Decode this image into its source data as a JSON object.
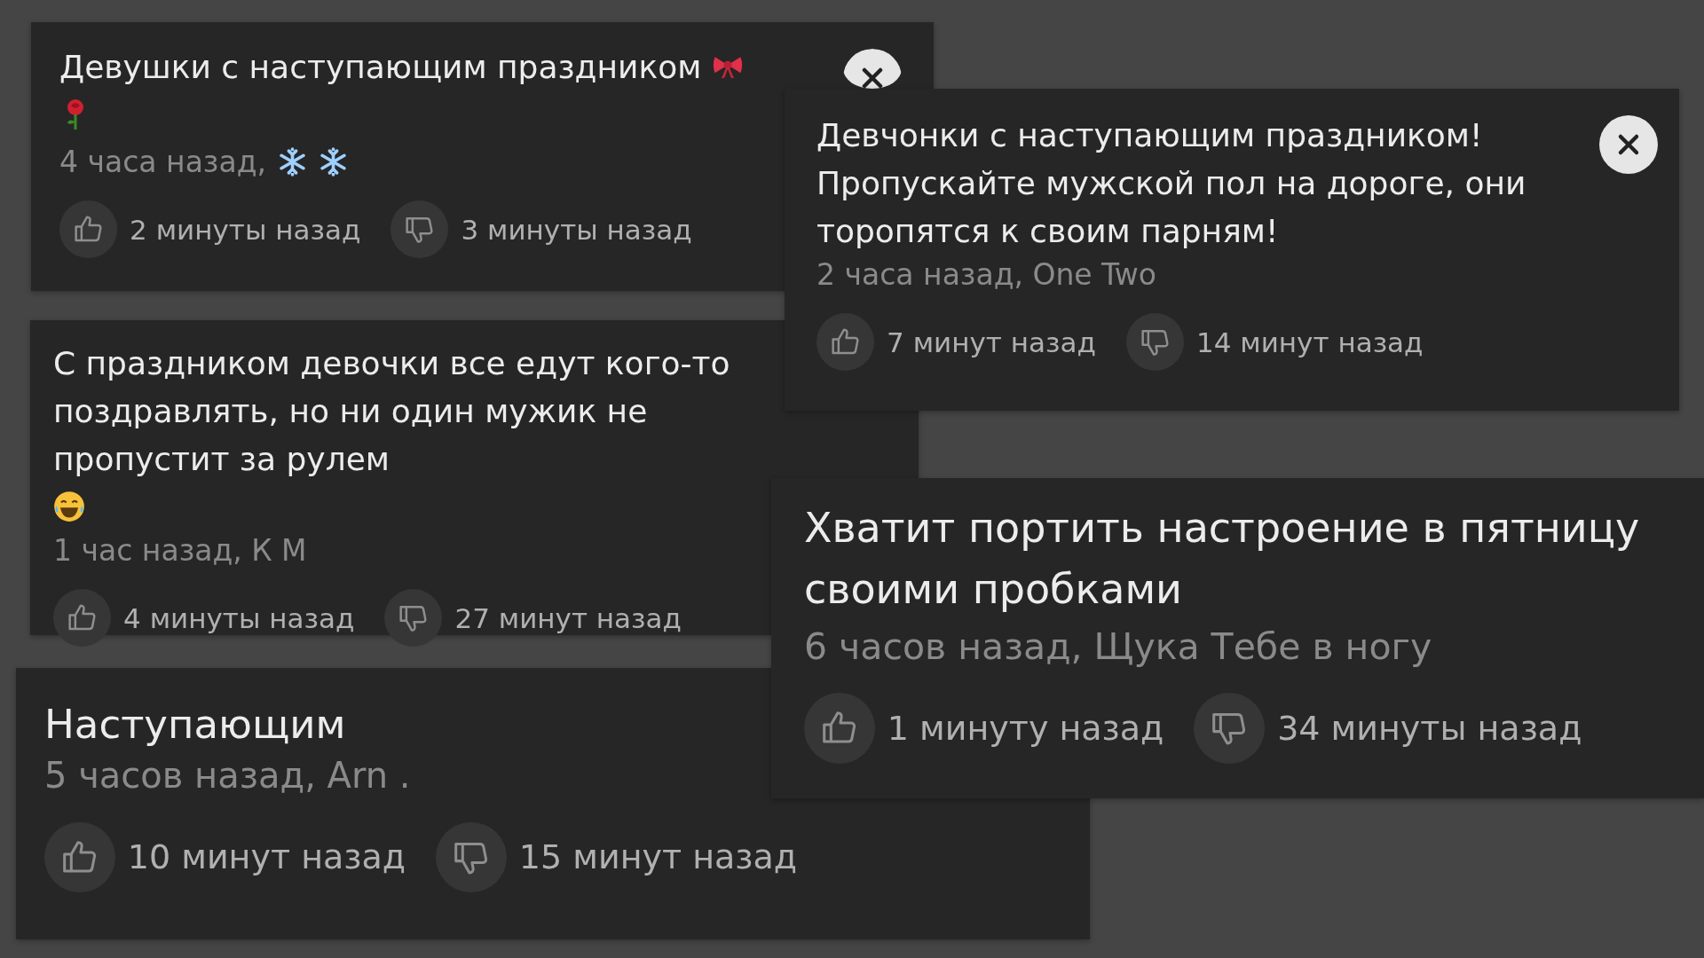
{
  "comments": [
    {
      "text": "Девушки с наступающим праздником",
      "meta": "4 часа назад,",
      "likes": "2 минуты назад",
      "dislikes": "3 минуты назад",
      "close_button": true
    },
    {
      "text": "С праздником девочки все едут кого-то поздравлять, но ни один мужик не пропустит за рулем",
      "meta": "1 час назад, К М",
      "likes": "4 минуты назад",
      "dislikes": "27 минут назад",
      "close_button": false
    },
    {
      "text": "Наступающим",
      "meta": "5 часов назад, Arn .",
      "likes": "10 минут назад",
      "dislikes": "15 минут назад",
      "close_button": false
    },
    {
      "text": "Девчонки с наступающим праздником! Пропускайте мужской пол на дороге, они торопятся к своим парням!",
      "meta": "2 часа назад, One Two",
      "likes": "7 минут назад",
      "dislikes": "14 минут назад",
      "close_button": true
    },
    {
      "text": "Хватит портить настроение в пятницу своими пробками",
      "meta": "6 часов назад, Щука Тебе в ногу",
      "likes": "1 минуту назад",
      "dislikes": "34 минуты назад",
      "close_button": false
    }
  ]
}
